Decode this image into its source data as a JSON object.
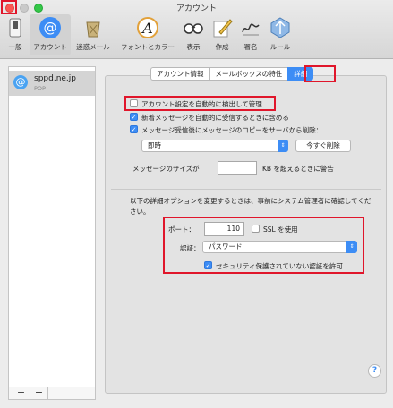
{
  "window": {
    "title": "アカウント"
  },
  "toolbar": {
    "items": [
      {
        "label": "一般",
        "icon": "general-switch-icon"
      },
      {
        "label": "アカウント",
        "icon": "at-sign-icon",
        "selected": true
      },
      {
        "label": "迷惑メール",
        "icon": "junk-trash-icon"
      },
      {
        "label": "フォントとカラー",
        "icon": "font-color-icon"
      },
      {
        "label": "表示",
        "icon": "glasses-icon"
      },
      {
        "label": "作成",
        "icon": "pencil-icon"
      },
      {
        "label": "署名",
        "icon": "signature-icon"
      },
      {
        "label": "ルール",
        "icon": "rules-icon"
      }
    ]
  },
  "sidebar": {
    "account": {
      "name": "sppd.ne.jp",
      "type": "POP"
    },
    "add_label": "+",
    "remove_label": "−"
  },
  "tabs": [
    {
      "label": "アカウント情報"
    },
    {
      "label": "メールボックスの特性"
    },
    {
      "label": "詳細",
      "active": true
    }
  ],
  "options": {
    "auto_detect": {
      "label": "アカウント設定を自動的に検出して管理",
      "checked": false
    },
    "include_auto_receive": {
      "label": "新着メッセージを自動的に受信するときに含める",
      "checked": true
    },
    "delete_copy": {
      "label": "メッセージ受信後にメッセージのコピーをサーバから削除：",
      "checked": true
    },
    "delete_timing": "即時",
    "delete_now_button": "今すぐ削除",
    "size_warning_prefix": "メッセージのサイズが",
    "size_warning_value": "",
    "size_warning_suffix": "KB を超えるときに警告"
  },
  "advanced": {
    "notice": "以下の詳細オプションを変更するときは、事前にシステム管理者に確認してください。",
    "port_label": "ポート：",
    "port_value": "110",
    "ssl_label": "SSL を使用",
    "ssl_checked": false,
    "auth_label": "認証：",
    "auth_value": "パスワード",
    "allow_insecure_label": "セキュリティ保護されていない認証を許可",
    "allow_insecure_checked": true
  },
  "help_label": "?",
  "colors": {
    "accent": "#3d8df5",
    "highlight_box": "#e0162b",
    "close": "#fc5753",
    "zoom": "#34c748"
  }
}
